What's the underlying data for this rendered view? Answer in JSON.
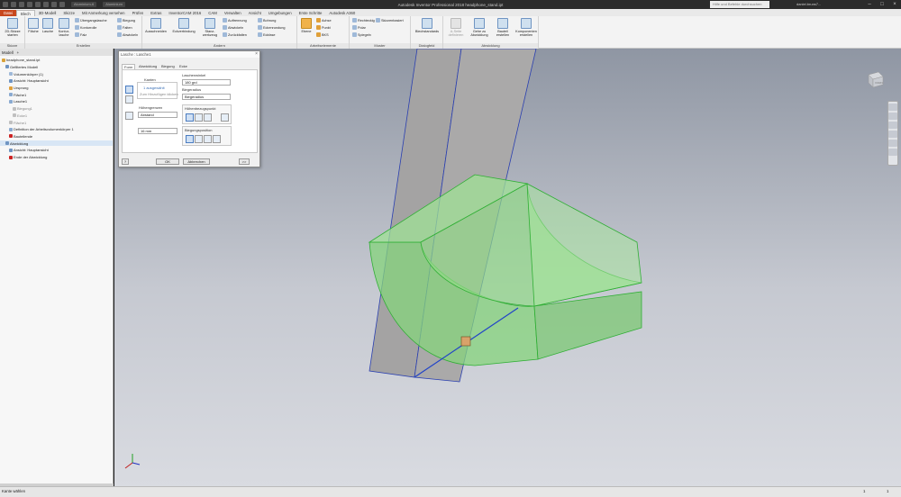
{
  "app": {
    "title": "Autodesk Inventor Professional 2018   headphone_stand.ipt",
    "search_placeholder": "Hilfe und Befehle durchsuchen",
    "user": "daniel.bruns7...",
    "qa_dropdown_1": "Aluminium-6",
    "qa_dropdown_2": "Aluminium"
  },
  "ribbon_tabs": [
    "Datei",
    "Blech",
    "3D-Modell",
    "Skizze",
    "Mit Anmerkung versehen",
    "Prüfen",
    "Extras",
    "InventorCAM 2016",
    "CAM",
    "Verwalten",
    "Ansicht",
    "Umgebungen",
    "Erste Schritte",
    "Autodesk A360"
  ],
  "ribbon": {
    "skizze": {
      "label": "Skizze",
      "btn_2d": "2D-Skizze starten"
    },
    "erstellen": {
      "label": "Erstellen",
      "flaeche": "Fläche",
      "lasche": "Lasche",
      "kontur": "Kontur-lasche",
      "uebergang": "Übergangslasche",
      "konturrolle": "Konturrolle",
      "falz": "Falz",
      "biegung": "Biegung",
      "falten": "Falten",
      "abwickeln": "Abwickeln"
    },
    "aendern": {
      "label": "Ändern",
      "ausschneiden": "Ausschneiden",
      "eckverbindung": "Eckverbindung",
      "stanz": "Stanz-werkzeug",
      "aufrennung": "Auftrennung",
      "abwickeln": "Abwickeln",
      "zurueckfalten": "Zurückfalten",
      "bohrung": "Bohrung",
      "eckenrundung": "Eckenrundung",
      "eckfase": "Eckfase"
    },
    "arbeitselemente": {
      "label": "Arbeitselemente",
      "ebene": "Ebene",
      "achse": "Achse",
      "punkt": "Punkt",
      "bks": "BKS"
    },
    "muster": {
      "label": "Muster",
      "rechteckig": "Rechteckig",
      "polar": "Polar",
      "spiegeln": "Spiegeln",
      "skizzenbasiert": "Skizzenbasiert"
    },
    "dialogfeld": {
      "label": "Dialogfeld",
      "blechstandards": "Blechstandards"
    },
    "abwicklung": {
      "label": "Abwicklung",
      "ab_seite": "A-Seite definieren",
      "gehe_zu": "Gehe zu Abwicklung",
      "bauteil": "Bauteil erstellen",
      "komponenten": "Komponenten erstellen"
    }
  },
  "browser": {
    "tab_model": "Modell",
    "tab_add": "+",
    "items": [
      {
        "label": "headphone_stand.ipt",
        "indent": 0
      },
      {
        "label": "Gefiltertes Modell",
        "indent": 1
      },
      {
        "label": "Volumenkörper (1)",
        "indent": 2
      },
      {
        "label": "Ansicht: Hauptansicht",
        "indent": 2
      },
      {
        "label": "Ursprung",
        "indent": 2
      },
      {
        "label": "Fläche1",
        "indent": 2
      },
      {
        "label": "Lasche1",
        "indent": 2
      },
      {
        "label": "Biegung1",
        "indent": 3
      },
      {
        "label": "Ecke1",
        "indent": 3
      },
      {
        "label": "Fläche1",
        "indent": 2
      },
      {
        "label": "Definition der Arbeitsvolumenkörper 1",
        "indent": 2
      },
      {
        "label": "Bauteilende",
        "indent": 2
      },
      {
        "label": "Abwicklung",
        "indent": 1
      },
      {
        "label": "Ansicht: Hauptansicht",
        "indent": 2
      },
      {
        "label": "Ende der Abwicklung",
        "indent": 2
      }
    ]
  },
  "dialog": {
    "title": "Lasche : Lasche1",
    "tabs": [
      "Form",
      "Abwicklung",
      "Biegung",
      "Ecke"
    ],
    "kanten_label": "Kanten",
    "kanten_value": "1 ausgewählt",
    "kanten_hint": "Zum Hinzufügen klicken",
    "laschenwinkel_label": "Laschenwinkel",
    "laschenwinkel_value": "180 grd",
    "biegeradius_label": "Biegeradius",
    "biegeradius_value": "Biegeradius",
    "hoehengrenzen_label": "Höhengrenzen",
    "hoehengrenzen_value": "Abstand",
    "hoehe_value": "16 mm",
    "hoehenbezugspunkt_label": "Höhenbezugspunkt",
    "biegungsposition_label": "Biegungsposition",
    "ok": "OK",
    "abbrechen": "Abbrechen",
    "more": ">>",
    "help": "?"
  },
  "viewcube_label": "VORN",
  "status": {
    "text": "Kante wählen",
    "n1": "1",
    "n2": "1"
  },
  "colors": {
    "accent": "#c8481e",
    "model_green": "#7fd06f",
    "model_grey": "#a4a3a3",
    "edge_blue": "#2143c8"
  }
}
